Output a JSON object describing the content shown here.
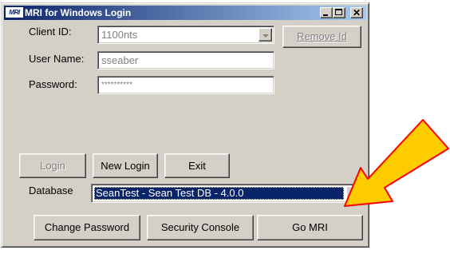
{
  "window": {
    "title": "MRI for Windows Login",
    "icon_text": "MRI",
    "controls": {
      "minimize_icon": "minimize-icon",
      "maximize_icon": "maximize-icon",
      "close_icon": "close-icon"
    }
  },
  "form": {
    "client_id_label": "Client ID:",
    "client_id_value": "1100nts",
    "remove_id_label": "Remove Id",
    "user_name_label": "User Name:",
    "user_name_value": "sseaber",
    "password_label": "Password:",
    "password_value": "**********"
  },
  "buttons": {
    "login": "Login",
    "new_login": "New Login",
    "exit": "Exit",
    "change_password": "Change Password",
    "security_console": "Security Console",
    "go_mri": "Go MRI"
  },
  "database": {
    "label": "Database",
    "selected": "SeanTest - Sean Test DB - 4.0.0"
  },
  "colors": {
    "title_start": "#0a246a",
    "title_end": "#a6caf0",
    "selection": "#0a246a",
    "face": "#d4d0c8",
    "arrow_fill": "#ffcc00",
    "arrow_stroke": "#ff0000"
  }
}
